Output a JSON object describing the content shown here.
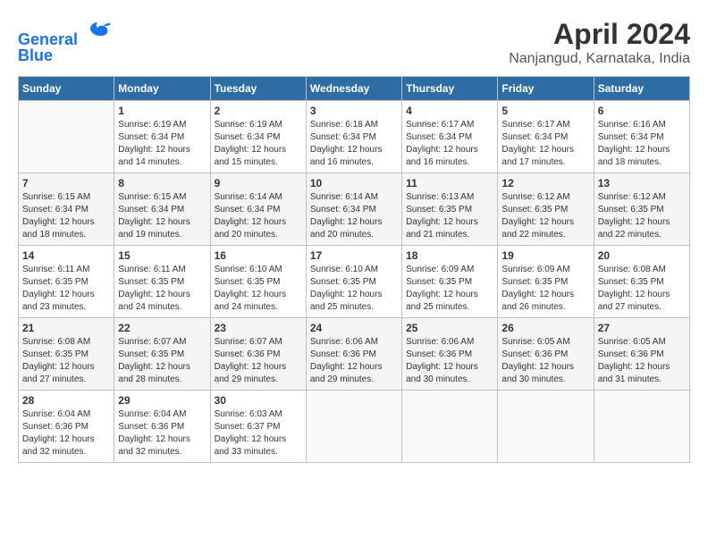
{
  "header": {
    "logo_line1": "General",
    "logo_line2": "Blue",
    "main_title": "April 2024",
    "subtitle": "Nanjangud, Karnataka, India"
  },
  "calendar": {
    "days_of_week": [
      "Sunday",
      "Monday",
      "Tuesday",
      "Wednesday",
      "Thursday",
      "Friday",
      "Saturday"
    ],
    "weeks": [
      [
        {
          "day": "",
          "info": ""
        },
        {
          "day": "1",
          "info": "Sunrise: 6:19 AM\nSunset: 6:34 PM\nDaylight: 12 hours\nand 14 minutes."
        },
        {
          "day": "2",
          "info": "Sunrise: 6:19 AM\nSunset: 6:34 PM\nDaylight: 12 hours\nand 15 minutes."
        },
        {
          "day": "3",
          "info": "Sunrise: 6:18 AM\nSunset: 6:34 PM\nDaylight: 12 hours\nand 16 minutes."
        },
        {
          "day": "4",
          "info": "Sunrise: 6:17 AM\nSunset: 6:34 PM\nDaylight: 12 hours\nand 16 minutes."
        },
        {
          "day": "5",
          "info": "Sunrise: 6:17 AM\nSunset: 6:34 PM\nDaylight: 12 hours\nand 17 minutes."
        },
        {
          "day": "6",
          "info": "Sunrise: 6:16 AM\nSunset: 6:34 PM\nDaylight: 12 hours\nand 18 minutes."
        }
      ],
      [
        {
          "day": "7",
          "info": "Sunrise: 6:15 AM\nSunset: 6:34 PM\nDaylight: 12 hours\nand 18 minutes."
        },
        {
          "day": "8",
          "info": "Sunrise: 6:15 AM\nSunset: 6:34 PM\nDaylight: 12 hours\nand 19 minutes."
        },
        {
          "day": "9",
          "info": "Sunrise: 6:14 AM\nSunset: 6:34 PM\nDaylight: 12 hours\nand 20 minutes."
        },
        {
          "day": "10",
          "info": "Sunrise: 6:14 AM\nSunset: 6:34 PM\nDaylight: 12 hours\nand 20 minutes."
        },
        {
          "day": "11",
          "info": "Sunrise: 6:13 AM\nSunset: 6:35 PM\nDaylight: 12 hours\nand 21 minutes."
        },
        {
          "day": "12",
          "info": "Sunrise: 6:12 AM\nSunset: 6:35 PM\nDaylight: 12 hours\nand 22 minutes."
        },
        {
          "day": "13",
          "info": "Sunrise: 6:12 AM\nSunset: 6:35 PM\nDaylight: 12 hours\nand 22 minutes."
        }
      ],
      [
        {
          "day": "14",
          "info": "Sunrise: 6:11 AM\nSunset: 6:35 PM\nDaylight: 12 hours\nand 23 minutes."
        },
        {
          "day": "15",
          "info": "Sunrise: 6:11 AM\nSunset: 6:35 PM\nDaylight: 12 hours\nand 24 minutes."
        },
        {
          "day": "16",
          "info": "Sunrise: 6:10 AM\nSunset: 6:35 PM\nDaylight: 12 hours\nand 24 minutes."
        },
        {
          "day": "17",
          "info": "Sunrise: 6:10 AM\nSunset: 6:35 PM\nDaylight: 12 hours\nand 25 minutes."
        },
        {
          "day": "18",
          "info": "Sunrise: 6:09 AM\nSunset: 6:35 PM\nDaylight: 12 hours\nand 25 minutes."
        },
        {
          "day": "19",
          "info": "Sunrise: 6:09 AM\nSunset: 6:35 PM\nDaylight: 12 hours\nand 26 minutes."
        },
        {
          "day": "20",
          "info": "Sunrise: 6:08 AM\nSunset: 6:35 PM\nDaylight: 12 hours\nand 27 minutes."
        }
      ],
      [
        {
          "day": "21",
          "info": "Sunrise: 6:08 AM\nSunset: 6:35 PM\nDaylight: 12 hours\nand 27 minutes."
        },
        {
          "day": "22",
          "info": "Sunrise: 6:07 AM\nSunset: 6:35 PM\nDaylight: 12 hours\nand 28 minutes."
        },
        {
          "day": "23",
          "info": "Sunrise: 6:07 AM\nSunset: 6:36 PM\nDaylight: 12 hours\nand 29 minutes."
        },
        {
          "day": "24",
          "info": "Sunrise: 6:06 AM\nSunset: 6:36 PM\nDaylight: 12 hours\nand 29 minutes."
        },
        {
          "day": "25",
          "info": "Sunrise: 6:06 AM\nSunset: 6:36 PM\nDaylight: 12 hours\nand 30 minutes."
        },
        {
          "day": "26",
          "info": "Sunrise: 6:05 AM\nSunset: 6:36 PM\nDaylight: 12 hours\nand 30 minutes."
        },
        {
          "day": "27",
          "info": "Sunrise: 6:05 AM\nSunset: 6:36 PM\nDaylight: 12 hours\nand 31 minutes."
        }
      ],
      [
        {
          "day": "28",
          "info": "Sunrise: 6:04 AM\nSunset: 6:36 PM\nDaylight: 12 hours\nand 32 minutes."
        },
        {
          "day": "29",
          "info": "Sunrise: 6:04 AM\nSunset: 6:36 PM\nDaylight: 12 hours\nand 32 minutes."
        },
        {
          "day": "30",
          "info": "Sunrise: 6:03 AM\nSunset: 6:37 PM\nDaylight: 12 hours\nand 33 minutes."
        },
        {
          "day": "",
          "info": ""
        },
        {
          "day": "",
          "info": ""
        },
        {
          "day": "",
          "info": ""
        },
        {
          "day": "",
          "info": ""
        }
      ]
    ]
  }
}
